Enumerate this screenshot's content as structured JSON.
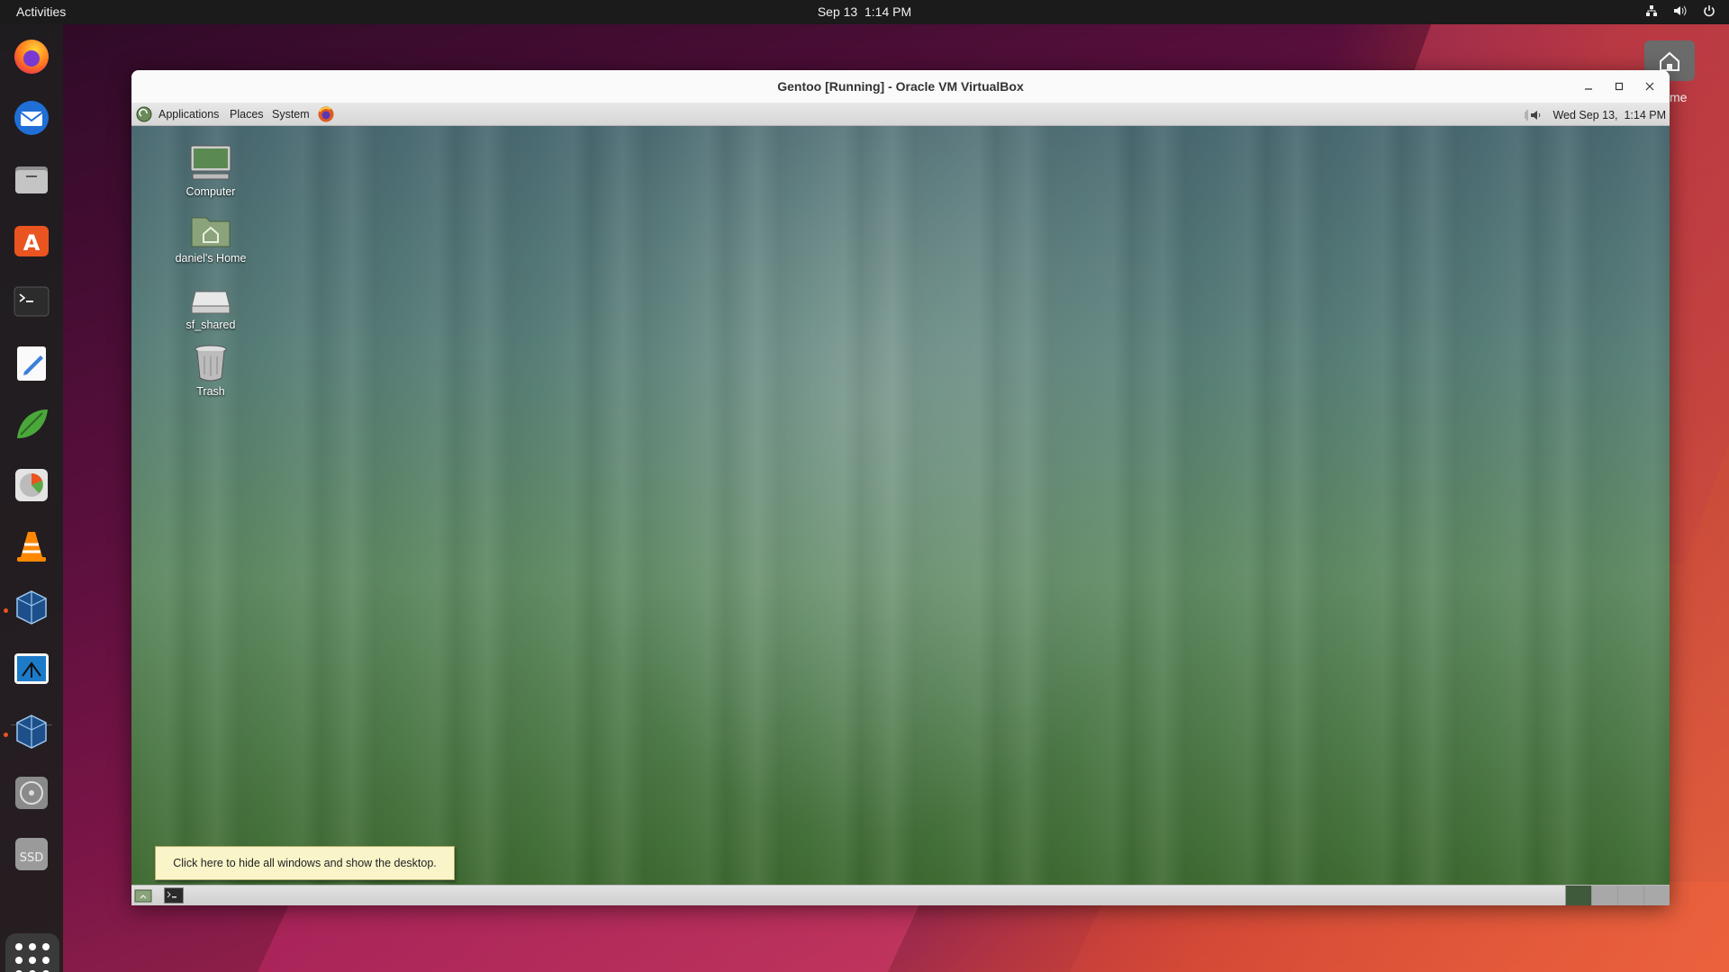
{
  "topbar": {
    "activities": "Activities",
    "date": "Sep 13",
    "time": "1:14 PM",
    "tray_icons": [
      "network-icon",
      "volume-icon",
      "power-icon"
    ]
  },
  "dock": {
    "items": [
      {
        "name": "firefox",
        "icon": "firefox-icon",
        "running": false
      },
      {
        "name": "thunderbird",
        "icon": "thunderbird-icon",
        "running": false
      },
      {
        "name": "files",
        "icon": "files-icon",
        "running": false
      },
      {
        "name": "app-center",
        "icon": "app-center-icon",
        "running": false
      },
      {
        "name": "terminal",
        "icon": "terminal-icon",
        "running": false
      },
      {
        "name": "text-editor",
        "icon": "text-editor-icon",
        "running": false
      },
      {
        "name": "notes",
        "icon": "leaf-pen-icon",
        "running": false
      },
      {
        "name": "disk-usage",
        "icon": "disk-usage-icon",
        "running": false
      },
      {
        "name": "vlc",
        "icon": "vlc-icon",
        "running": false
      },
      {
        "name": "virtualbox",
        "icon": "virtualbox-icon",
        "running": true
      },
      {
        "name": "remmina",
        "icon": "remote-desktop-icon",
        "running": false
      },
      {
        "name": "virtualbox-vm",
        "icon": "virtualbox-icon",
        "running": true
      },
      {
        "name": "optical-drive",
        "icon": "optical-drive-icon",
        "running": false
      },
      {
        "name": "ssd",
        "icon": "ssd-icon",
        "label": "SSD",
        "running": false
      }
    ],
    "show_apps": "show-apps-icon"
  },
  "host_desktop": {
    "home_label": "me"
  },
  "vbox_window": {
    "title": "Gentoo [Running] - Oracle VM VirtualBox",
    "controls": [
      "minimize",
      "maximize",
      "close"
    ]
  },
  "guest": {
    "menu": {
      "applications": "Applications",
      "places": "Places",
      "system": "System"
    },
    "clock": "Wed Sep 13,  1:14 PM",
    "desktop_icons": [
      {
        "label": "Computer",
        "icon": "computer-icon"
      },
      {
        "label": "daniel's Home",
        "icon": "home-folder-icon"
      },
      {
        "label": "sf_shared",
        "icon": "drive-icon"
      },
      {
        "label": "Trash",
        "icon": "trash-icon"
      }
    ],
    "tooltip": "Click here to hide all windows and show the desktop.",
    "workspaces": 4,
    "active_workspace": 1
  },
  "colors": {
    "ubuntu_orange": "#e95420",
    "tooltip_bg": "#f9f5c9"
  }
}
